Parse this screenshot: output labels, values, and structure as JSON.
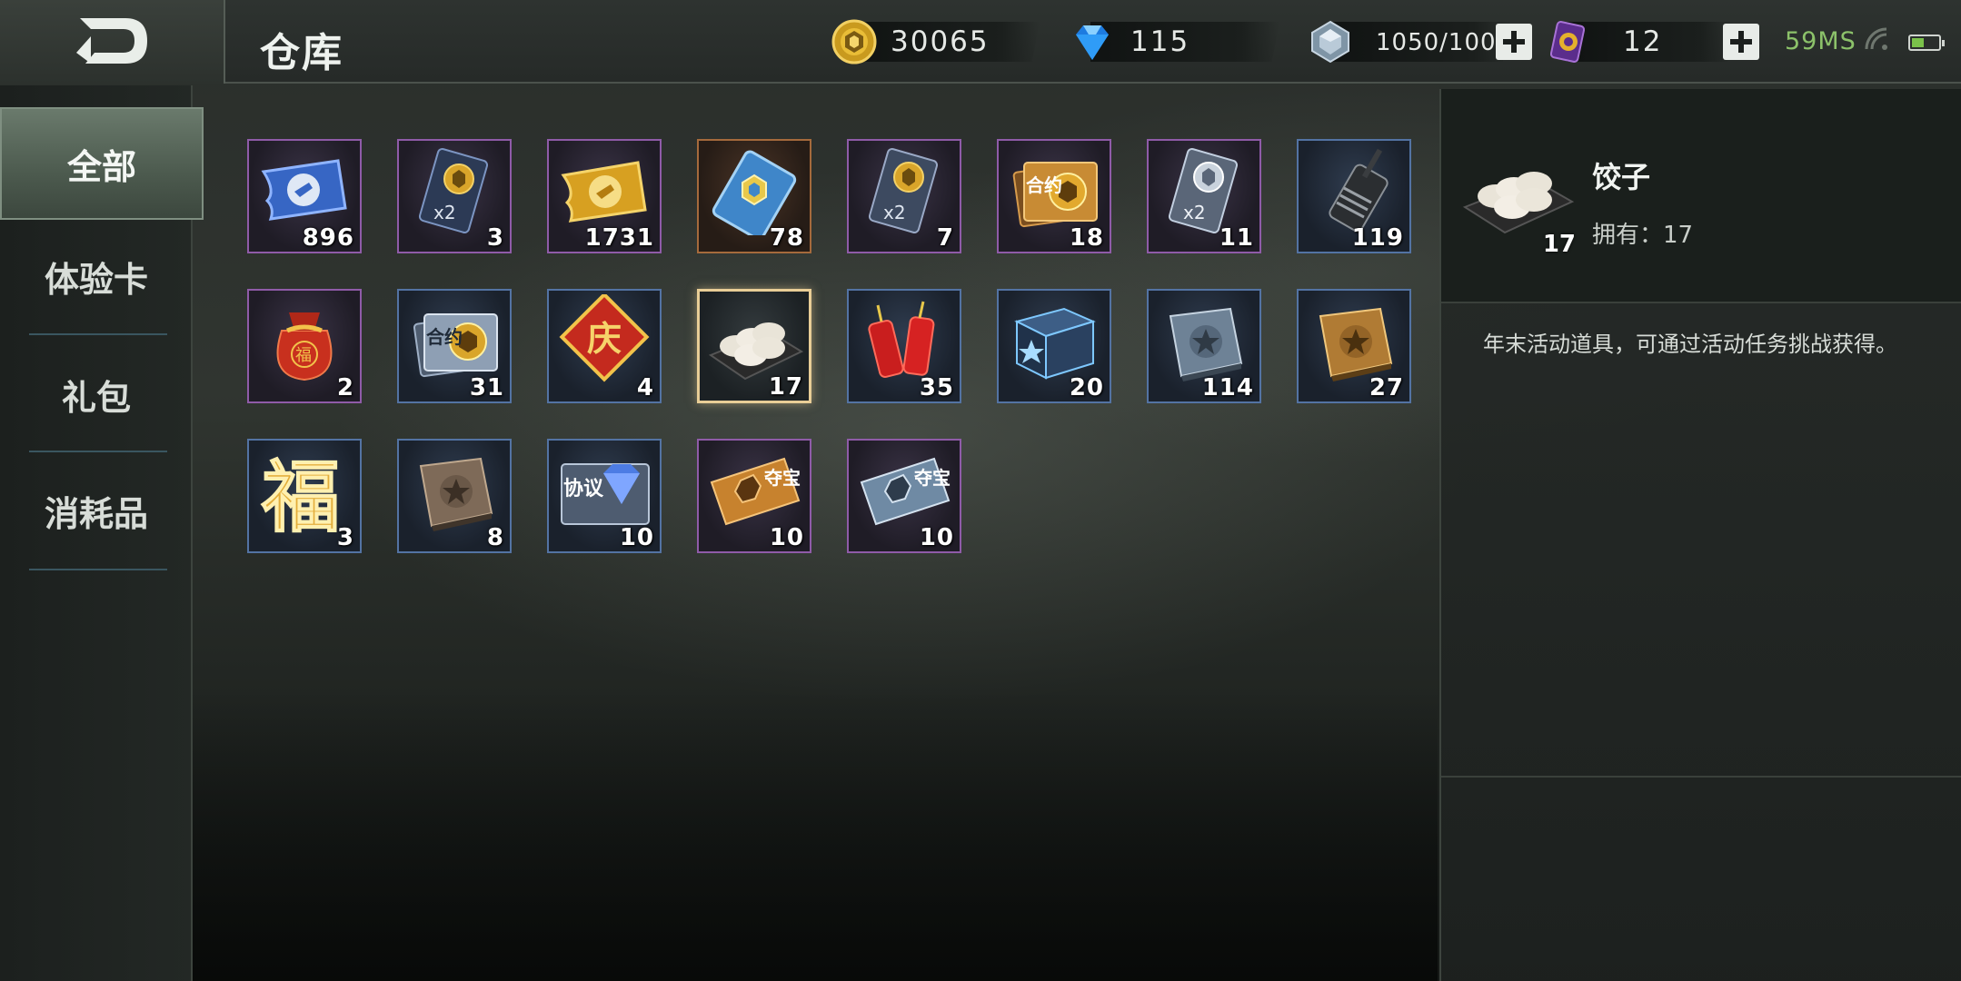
{
  "header": {
    "title": "仓库",
    "resources": {
      "gold": "30065",
      "diamond": "115",
      "crystal": "1050/100",
      "ticket": "12"
    },
    "ping": "59MS",
    "battery_level": 0.45
  },
  "sidebar": {
    "tabs": [
      {
        "label": "全部",
        "active": true
      },
      {
        "label": "体验卡",
        "active": false
      },
      {
        "label": "礼包",
        "active": false
      },
      {
        "label": "消耗品",
        "active": false
      }
    ]
  },
  "items": [
    {
      "name": "blue-ticket",
      "count": "896",
      "frame": "purple"
    },
    {
      "name": "gold-card-x2",
      "count": "3",
      "frame": "purple"
    },
    {
      "name": "gold-ticket",
      "count": "1731",
      "frame": "purple"
    },
    {
      "name": "blue-card",
      "count": "78",
      "frame": "orange"
    },
    {
      "name": "gold-card-x2-b",
      "count": "7",
      "frame": "purple"
    },
    {
      "name": "contract-gold",
      "count": "18",
      "frame": "purple"
    },
    {
      "name": "silver-card-x2",
      "count": "11",
      "frame": "purple"
    },
    {
      "name": "walkie-talkie",
      "count": "119",
      "frame": "blue"
    },
    {
      "name": "lucky-bag",
      "count": "2",
      "frame": "purple"
    },
    {
      "name": "contract-silver",
      "count": "31",
      "frame": "blue"
    },
    {
      "name": "celebration-tile",
      "count": "4",
      "frame": "blue"
    },
    {
      "name": "dumplings",
      "count": "17",
      "frame": "selected"
    },
    {
      "name": "firecrackers",
      "count": "35",
      "frame": "blue"
    },
    {
      "name": "blue-crate",
      "count": "20",
      "frame": "blue"
    },
    {
      "name": "silver-book",
      "count": "114",
      "frame": "blue"
    },
    {
      "name": "gold-book",
      "count": "27",
      "frame": "blue"
    },
    {
      "name": "fu-character",
      "count": "3",
      "frame": "blue"
    },
    {
      "name": "brown-book",
      "count": "8",
      "frame": "blue"
    },
    {
      "name": "protocol-diamond",
      "count": "10",
      "frame": "blue"
    },
    {
      "name": "treasure-ticket-gold",
      "count": "10",
      "frame": "purple"
    },
    {
      "name": "treasure-ticket-silver",
      "count": "10",
      "frame": "purple"
    }
  ],
  "item_labels": {
    "fu": "福",
    "qing": "庆",
    "heyue": "合约",
    "xieyi": "协议",
    "duobao": "夺宝",
    "x2": "x2"
  },
  "detail": {
    "name": "饺子",
    "count": "17",
    "owned": "拥有：17",
    "description": "年末活动道具，可通过活动任务挑战获得。"
  },
  "colors": {
    "accent_tab": "#5a6a5c",
    "ping": "#8cc26a",
    "selected_frame": "#e8cd96"
  }
}
